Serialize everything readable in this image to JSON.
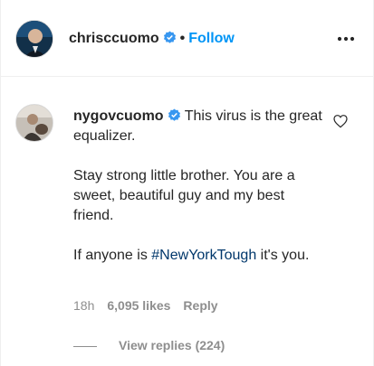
{
  "post": {
    "author": "chrisccuomo",
    "dot": "•",
    "follow_label": "Follow"
  },
  "comment": {
    "author": "nygovcuomo",
    "line1": "This virus is the great equalizer.",
    "paragraph2": "Stay strong little brother. You are a sweet, beautiful guy and my best friend.",
    "paragraph3_prefix": "If anyone is ",
    "hashtag": "#NewYorkTough",
    "paragraph3_suffix": " it's you.",
    "time": "18h",
    "likes": "6,095 likes",
    "reply_label": "Reply",
    "view_replies": "View replies (224)"
  },
  "icons": {
    "verified": "verified-badge-icon",
    "more": "more-options-icon",
    "like": "heart-icon"
  },
  "colors": {
    "accent": "#0095f6",
    "verified": "#3897f0",
    "hashtag": "#00376b",
    "muted": "#8e8e8e"
  }
}
